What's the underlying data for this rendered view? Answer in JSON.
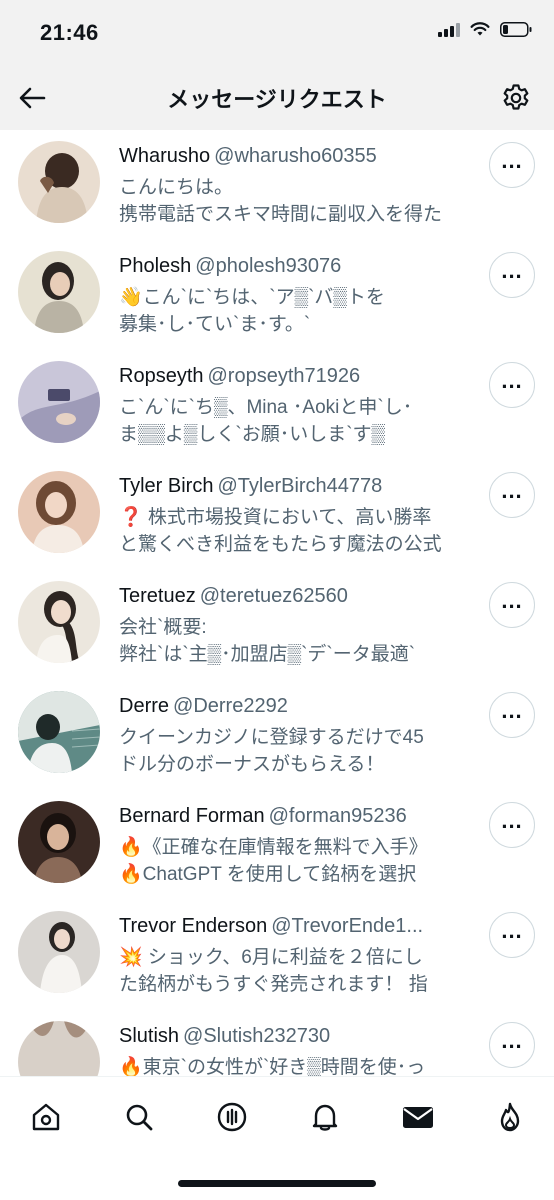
{
  "status_bar": {
    "time": "21:46"
  },
  "header": {
    "title": "メッセージリクエスト"
  },
  "requests": [
    {
      "name": "Wharusho",
      "handle": "@wharusho60355",
      "message": "こんにちは。\n携帯電話でスキマ時間に副収入を得た",
      "avatar_colors": [
        "#e9ddd0",
        "#7a5a44"
      ]
    },
    {
      "name": "Pholesh",
      "handle": "@pholesh93076",
      "message": "👋こん`に`ちは、`ア▒`バ▒トを\n募集･し･てい`ま･す。`",
      "avatar_colors": [
        "#e6e1d2",
        "#3a3430"
      ]
    },
    {
      "name": "Ropseyth",
      "handle": "@ropseyth71926",
      "message": "こ`ん`に`ち▒、Mina ･Aokiと申`し･\nま▒▒よ▒しく`お願･いしま`す▒",
      "avatar_colors": [
        "#c9c6d9",
        "#4b4a6a"
      ]
    },
    {
      "name": "Tyler Birch",
      "handle": "@TylerBirch44778",
      "message": "❓ 株式市場投資において、高い勝率\nと驚くべき利益をもたらす魔法の公式",
      "avatar_colors": [
        "#e8c9b6",
        "#8a5b3e"
      ]
    },
    {
      "name": "Teretuez",
      "handle": "@teretuez62560",
      "message": "会社`概要:\n弊社`は`主▒･加盟店▒`デ`ータ最適`",
      "avatar_colors": [
        "#ece7de",
        "#2d2622"
      ]
    },
    {
      "name": "Derre",
      "handle": "@Derre2292",
      "message": "クイーンカジノに登録するだけで45\nドル分のボーナスがもらえる！",
      "avatar_colors": [
        "#5f8a86",
        "#1f3b3a"
      ]
    },
    {
      "name": "Bernard Forman",
      "handle": "@forman95236",
      "message": "🔥《正確な在庫情報を無料で入手》\n🔥ChatGPT を使用して銘柄を選択",
      "avatar_colors": [
        "#3b2a24",
        "#d9b49a"
      ]
    },
    {
      "name": "Trevor Enderson",
      "handle": "@TrevorEnde1...",
      "message": "💥 ショック、6月に利益を２倍にし\nた銘柄がもうすぐ発売されます！ 指",
      "avatar_colors": [
        "#d9d6d2",
        "#2a2624"
      ]
    },
    {
      "name": "Slutish",
      "handle": "@Slutish232730",
      "message": "🔥東京`の女性が`好き▒時間を使･っ",
      "avatar_colors": [
        "#d8d0c8",
        "#a58e7e"
      ]
    }
  ],
  "icons": {
    "back": "back-arrow-icon",
    "settings": "gear-icon",
    "more": "more-icon",
    "tabs": [
      "home-icon",
      "search-icon",
      "spaces-icon",
      "notifications-icon",
      "messages-icon",
      "flame-icon"
    ]
  }
}
